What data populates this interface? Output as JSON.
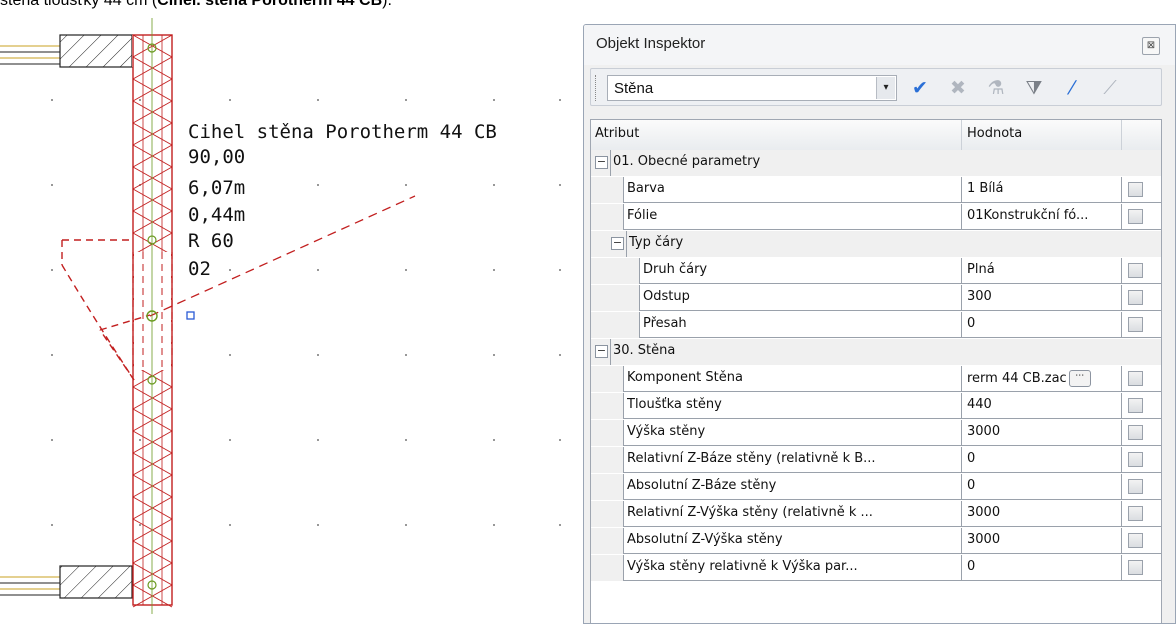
{
  "document": {
    "line_prefix": "stěna tloušťky 44 cm (",
    "line_bold": "Cihel. stěna Porotherm 44 CB",
    "line_suffix": ")."
  },
  "cad": {
    "labels": [
      "Cihel stěna Porotherm 44 CB",
      "90,00",
      "6,07m",
      "0,44m",
      "R 60",
      "02"
    ]
  },
  "inspector": {
    "title": "Objekt Inspektor",
    "close_glyph": "⊠",
    "object_type": "Stěna",
    "dropdown_glyph": "▾",
    "columns": {
      "attribute": "Atribut",
      "value": "Hodnota"
    },
    "toolbar": [
      {
        "name": "apply-check-icon",
        "glyph": "✔",
        "color": "#2a6fd6"
      },
      {
        "name": "cancel-icon",
        "glyph": "✖",
        "color": "#b0b6bf"
      },
      {
        "name": "pipette-icon",
        "glyph": "⚗",
        "color": "#b0b6bf"
      },
      {
        "name": "filter-icon",
        "glyph": "⧩",
        "color": "#7a7f87"
      },
      {
        "name": "pick-attribute-icon",
        "glyph": "⁄",
        "color": "#2a6fd6"
      },
      {
        "name": "wand-icon",
        "glyph": "⟋",
        "color": "#b0b6bf"
      }
    ],
    "groups": [
      {
        "toggle": "−",
        "label": "01. Obecné parametry"
      },
      {
        "toggle": "−",
        "label": "Typ čáry"
      },
      {
        "toggle": "−",
        "label": "30. Stěna"
      }
    ],
    "rows": [
      {
        "label": "Barva",
        "value": "  1     Bílá"
      },
      {
        "label": "Fólie",
        "value": "01Konstrukční fó..."
      },
      {
        "label": "Druh čáry",
        "value": "Plná"
      },
      {
        "label": "Odstup",
        "value": "300"
      },
      {
        "label": "Přesah",
        "value": "0"
      },
      {
        "label": "Komponent Stěna",
        "value": "rerm 44 CB.zac"
      },
      {
        "label": "Tloušťka stěny",
        "value": "440"
      },
      {
        "label": "Výška stěny",
        "value": "3000"
      },
      {
        "label": "Relativní Z-Báze stěny (relativně k B...",
        "value": "0"
      },
      {
        "label": "Absolutní Z-Báze stěny",
        "value": "0"
      },
      {
        "label": "Relativní Z-Výška stěny (relativně k ...",
        "value": "3000"
      },
      {
        "label": "Absolutní Z-Výška stěny",
        "value": "3000"
      },
      {
        "label": "Výška stěny relativně k Výška par...",
        "value": "0"
      }
    ],
    "ellipsis_glyph": "⋯"
  }
}
